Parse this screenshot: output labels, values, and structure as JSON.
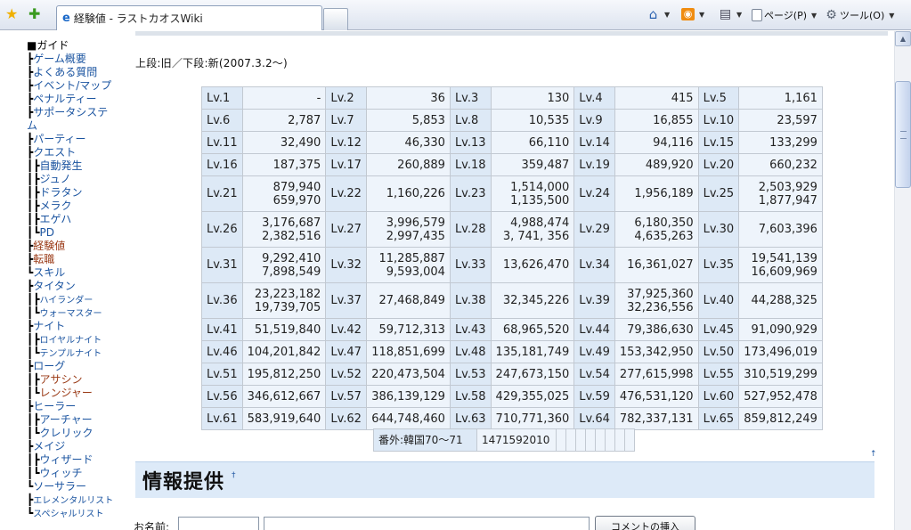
{
  "browser": {
    "tab_title": "経験値 - ラストカオスWiki",
    "commands": {
      "page": "ページ(P)",
      "tools": "ツール(O)"
    }
  },
  "sidebar": {
    "heading": "■ガイド",
    "items": [
      {
        "tree": "┣",
        "label": "ゲーム概要"
      },
      {
        "tree": "┣",
        "label": "よくある質問"
      },
      {
        "tree": "┣",
        "label": "イベント/マップ"
      },
      {
        "tree": "┣",
        "label": "ペナルティー"
      },
      {
        "tree": "┣",
        "label": "サポータシステ"
      },
      {
        "tree": "",
        "label": "ム"
      },
      {
        "tree": "┣",
        "label": "パーティー"
      },
      {
        "tree": "┣",
        "label": "クエスト"
      },
      {
        "tree": "┃┣",
        "label": "自動発生"
      },
      {
        "tree": "┃┣",
        "label": "ジュノ"
      },
      {
        "tree": "┃┣",
        "label": "ドラタン"
      },
      {
        "tree": "┃┣",
        "label": "メラク"
      },
      {
        "tree": "┃┣",
        "label": "エゲハ"
      },
      {
        "tree": "┃┗",
        "label": "PD"
      },
      {
        "tree": "┣",
        "label": "経験値",
        "visited": true
      },
      {
        "tree": "┣",
        "label": "転職",
        "visited": true
      },
      {
        "tree": "┗",
        "label": "スキル"
      },
      {
        "tree": " ┣",
        "label": "タイタン"
      },
      {
        "tree": " ┃┣",
        "label": "ハイランダー",
        "small": true
      },
      {
        "tree": " ┃┗",
        "label": "ウォーマスター",
        "small": true
      },
      {
        "tree": " ┣",
        "label": "ナイト"
      },
      {
        "tree": " ┃┣",
        "label": "ロイヤルナイト",
        "small": true
      },
      {
        "tree": " ┃┗",
        "label": "テンプルナイト",
        "small": true
      },
      {
        "tree": " ┣",
        "label": "ローグ"
      },
      {
        "tree": " ┃┣",
        "label": "アサシン",
        "visited": true
      },
      {
        "tree": " ┃┗",
        "label": "レンジャー",
        "visited": true
      },
      {
        "tree": " ┣",
        "label": "ヒーラー"
      },
      {
        "tree": " ┃┣",
        "label": "アーチャー"
      },
      {
        "tree": " ┃┗",
        "label": "クレリック"
      },
      {
        "tree": " ┣",
        "label": "メイジ"
      },
      {
        "tree": " ┃┣",
        "label": "ウィザード"
      },
      {
        "tree": " ┃┗",
        "label": "ウィッチ"
      },
      {
        "tree": " ┗",
        "label": "ソーサラー"
      },
      {
        "tree": "  ┣",
        "label": "エレメンタルリスト",
        "small": true
      },
      {
        "tree": "  ┗",
        "label": "スペシャルリスト",
        "small": true
      }
    ]
  },
  "main": {
    "note": "上段:旧／下段:新(2007.3.2〜)",
    "xp_rows": [
      [
        [
          "Lv.1",
          "-"
        ],
        [
          "Lv.2",
          "36"
        ],
        [
          "Lv.3",
          "130"
        ],
        [
          "Lv.4",
          "415"
        ],
        [
          "Lv.5",
          "1,161"
        ]
      ],
      [
        [
          "Lv.6",
          "2,787"
        ],
        [
          "Lv.7",
          "5,853"
        ],
        [
          "Lv.8",
          "10,535"
        ],
        [
          "Lv.9",
          "16,855"
        ],
        [
          "Lv.10",
          "23,597"
        ]
      ],
      [
        [
          "Lv.11",
          "32,490"
        ],
        [
          "Lv.12",
          "46,330"
        ],
        [
          "Lv.13",
          "66,110"
        ],
        [
          "Lv.14",
          "94,116"
        ],
        [
          "Lv.15",
          "133,299"
        ]
      ],
      [
        [
          "Lv.16",
          "187,375"
        ],
        [
          "Lv.17",
          "260,889"
        ],
        [
          "Lv.18",
          "359,487"
        ],
        [
          "Lv.19",
          "489,920"
        ],
        [
          "Lv.20",
          "660,232"
        ]
      ],
      [
        [
          "Lv.21",
          "879,940",
          "659,970"
        ],
        [
          "Lv.22",
          "1,160,226"
        ],
        [
          "Lv.23",
          "1,514,000",
          "1,135,500"
        ],
        [
          "Lv.24",
          "1,956,189"
        ],
        [
          "Lv.25",
          "2,503,929",
          "1,877,947"
        ]
      ],
      [
        [
          "Lv.26",
          "3,176,687",
          "2,382,516"
        ],
        [
          "Lv.27",
          "3,996,579",
          "2,997,435"
        ],
        [
          "Lv.28",
          "4,988,474",
          "3, 741, 356"
        ],
        [
          "Lv.29",
          "6,180,350",
          "4,635,263"
        ],
        [
          "Lv.30",
          "7,603,396"
        ]
      ],
      [
        [
          "Lv.31",
          "9,292,410",
          "7,898,549"
        ],
        [
          "Lv.32",
          "11,285,887",
          "9,593,004"
        ],
        [
          "Lv.33",
          "13,626,470"
        ],
        [
          "Lv.34",
          "16,361,027"
        ],
        [
          "Lv.35",
          "19,541,139",
          "16,609,969"
        ]
      ],
      [
        [
          "Lv.36",
          "23,223,182",
          "19,739,705"
        ],
        [
          "Lv.37",
          "27,468,849"
        ],
        [
          "Lv.38",
          "32,345,226"
        ],
        [
          "Lv.39",
          "37,925,360",
          "32,236,556"
        ],
        [
          "Lv.40",
          "44,288,325"
        ]
      ],
      [
        [
          "Lv.41",
          "51,519,840"
        ],
        [
          "Lv.42",
          "59,712,313"
        ],
        [
          "Lv.43",
          "68,965,520"
        ],
        [
          "Lv.44",
          "79,386,630"
        ],
        [
          "Lv.45",
          "91,090,929"
        ]
      ],
      [
        [
          "Lv.46",
          "104,201,842"
        ],
        [
          "Lv.47",
          "118,851,699"
        ],
        [
          "Lv.48",
          "135,181,749"
        ],
        [
          "Lv.49",
          "153,342,950"
        ],
        [
          "Lv.50",
          "173,496,019"
        ]
      ],
      [
        [
          "Lv.51",
          "195,812,250"
        ],
        [
          "Lv.52",
          "220,473,504"
        ],
        [
          "Lv.53",
          "247,673,150"
        ],
        [
          "Lv.54",
          "277,615,998"
        ],
        [
          "Lv.55",
          "310,519,299"
        ]
      ],
      [
        [
          "Lv.56",
          "346,612,667"
        ],
        [
          "Lv.57",
          "386,139,129"
        ],
        [
          "Lv.58",
          "429,355,025"
        ],
        [
          "Lv.59",
          "476,531,120"
        ],
        [
          "Lv.60",
          "527,952,478"
        ]
      ],
      [
        [
          "Lv.61",
          "583,919,640"
        ],
        [
          "Lv.62",
          "644,748,460"
        ],
        [
          "Lv.63",
          "710,771,360"
        ],
        [
          "Lv.64",
          "782,337,131"
        ],
        [
          "Lv.65",
          "859,812,249"
        ]
      ]
    ],
    "extra": {
      "label": "番外:韓国70〜71",
      "value": "1471592010"
    },
    "section_title": "情報提供",
    "section_anchor": "†",
    "up_link": "↑",
    "form": {
      "name_label": "お名前:",
      "submit_label": "コメントの挿入"
    }
  }
}
